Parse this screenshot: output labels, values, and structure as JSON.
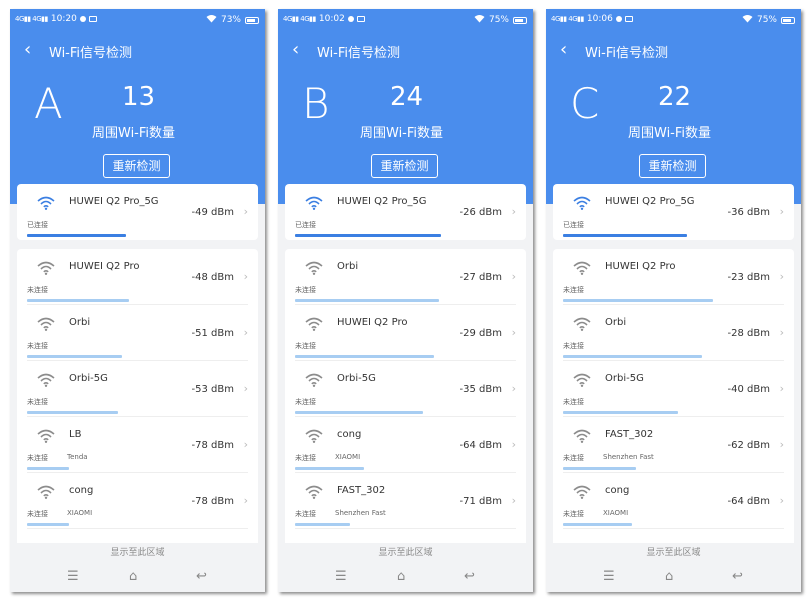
{
  "colors": {
    "header": "#4a8ded",
    "active_bar": "#3b7fe2",
    "bar": "#a7cdf2"
  },
  "panels": [
    {
      "label": "A",
      "status": {
        "time": "10:20",
        "battery": "73%"
      },
      "title": "Wi-Fi信号检测",
      "count": "13",
      "count_caption": "周围Wi-Fi数量",
      "recheck": "重新检测",
      "connected": {
        "ssid": "HUWEI Q2 Pro_5G",
        "status": "已连接",
        "dbm": "-49 dBm",
        "strength": 0.45
      },
      "networks": [
        {
          "ssid": "HUWEI Q2 Pro",
          "status": "未连接",
          "vendor": "",
          "dbm": "-48 dBm",
          "strength": 0.46
        },
        {
          "ssid": "Orbi",
          "status": "未连接",
          "vendor": "",
          "dbm": "-51 dBm",
          "strength": 0.43
        },
        {
          "ssid": "Orbi-5G",
          "status": "未连接",
          "vendor": "",
          "dbm": "-53 dBm",
          "strength": 0.41
        },
        {
          "ssid": "LB",
          "status": "未连接",
          "vendor": "Tenda",
          "dbm": "-78 dBm",
          "strength": 0.19
        },
        {
          "ssid": "cong",
          "status": "未连接",
          "vendor": "XIAOMI",
          "dbm": "-78 dBm",
          "strength": 0.19
        }
      ],
      "footer_hint": "显示至此区域"
    },
    {
      "label": "B",
      "status": {
        "time": "10:02",
        "battery": "75%"
      },
      "title": "Wi-Fi信号检测",
      "count": "24",
      "count_caption": "周围Wi-Fi数量",
      "recheck": "重新检测",
      "connected": {
        "ssid": "HUWEI Q2 Pro_5G",
        "status": "已连接",
        "dbm": "-26 dBm",
        "strength": 0.66
      },
      "networks": [
        {
          "ssid": "Orbi",
          "status": "未连接",
          "vendor": "",
          "dbm": "-27 dBm",
          "strength": 0.65
        },
        {
          "ssid": "HUWEI Q2 Pro",
          "status": "未连接",
          "vendor": "",
          "dbm": "-29 dBm",
          "strength": 0.63
        },
        {
          "ssid": "Orbi-5G",
          "status": "未连接",
          "vendor": "",
          "dbm": "-35 dBm",
          "strength": 0.58
        },
        {
          "ssid": "cong",
          "status": "未连接",
          "vendor": "XIAOMI",
          "dbm": "-64 dBm",
          "strength": 0.31
        },
        {
          "ssid": "FAST_302",
          "status": "未连接",
          "vendor": "Shenzhen Fast",
          "dbm": "-71 dBm",
          "strength": 0.25
        }
      ],
      "footer_hint": "显示至此区域"
    },
    {
      "label": "C",
      "status": {
        "time": "10:06",
        "battery": "75%"
      },
      "title": "Wi-Fi信号检测",
      "count": "22",
      "count_caption": "周围Wi-Fi数量",
      "recheck": "重新检测",
      "connected": {
        "ssid": "HUWEI Q2 Pro_5G",
        "status": "已连接",
        "dbm": "-36 dBm",
        "strength": 0.56
      },
      "networks": [
        {
          "ssid": "HUWEI Q2 Pro",
          "status": "未连接",
          "vendor": "",
          "dbm": "-23 dBm",
          "strength": 0.68
        },
        {
          "ssid": "Orbi",
          "status": "未连接",
          "vendor": "",
          "dbm": "-28 dBm",
          "strength": 0.63
        },
        {
          "ssid": "Orbi-5G",
          "status": "未连接",
          "vendor": "",
          "dbm": "-40 dBm",
          "strength": 0.52
        },
        {
          "ssid": "FAST_302",
          "status": "未连接",
          "vendor": "Shenzhen Fast",
          "dbm": "-62 dBm",
          "strength": 0.33
        },
        {
          "ssid": "cong",
          "status": "未连接",
          "vendor": "XIAOMI",
          "dbm": "-64 dBm",
          "strength": 0.31
        }
      ],
      "footer_hint": "显示至此区域"
    }
  ]
}
